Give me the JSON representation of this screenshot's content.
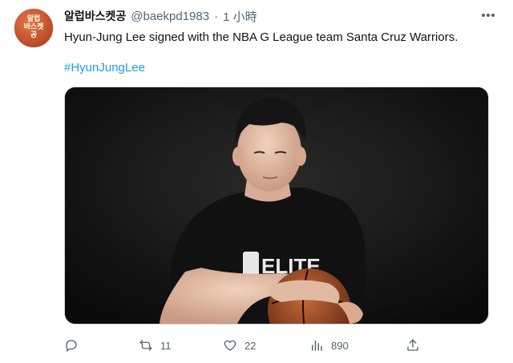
{
  "user": {
    "display_name": "알럽바스켓공",
    "handle": "@baekpd1983",
    "separator": "·",
    "time": "1 小時",
    "avatar_text": "알럽\n바스켓\n공"
  },
  "tweet": {
    "text": "Hyun-Jung Lee signed with the NBA G League team Santa Cruz Warriors.",
    "hashtag": "#HyunJungLee"
  },
  "media": {
    "alt": "Portrait photo of a basketball player in a black shirt holding a basketball",
    "shirt_text": "ELITE"
  },
  "actions": {
    "reply_count": "",
    "retweet_count": "11",
    "like_count": "22",
    "view_count": "890"
  },
  "icons": {
    "more": "more-icon",
    "reply": "reply-icon",
    "retweet": "retweet-icon",
    "like": "heart-icon",
    "views": "views-icon",
    "share": "share-icon"
  },
  "colors": {
    "accent": "#1d9bf0",
    "secondary_text": "#536471",
    "text": "#0f1419",
    "background": "#ffffff"
  }
}
